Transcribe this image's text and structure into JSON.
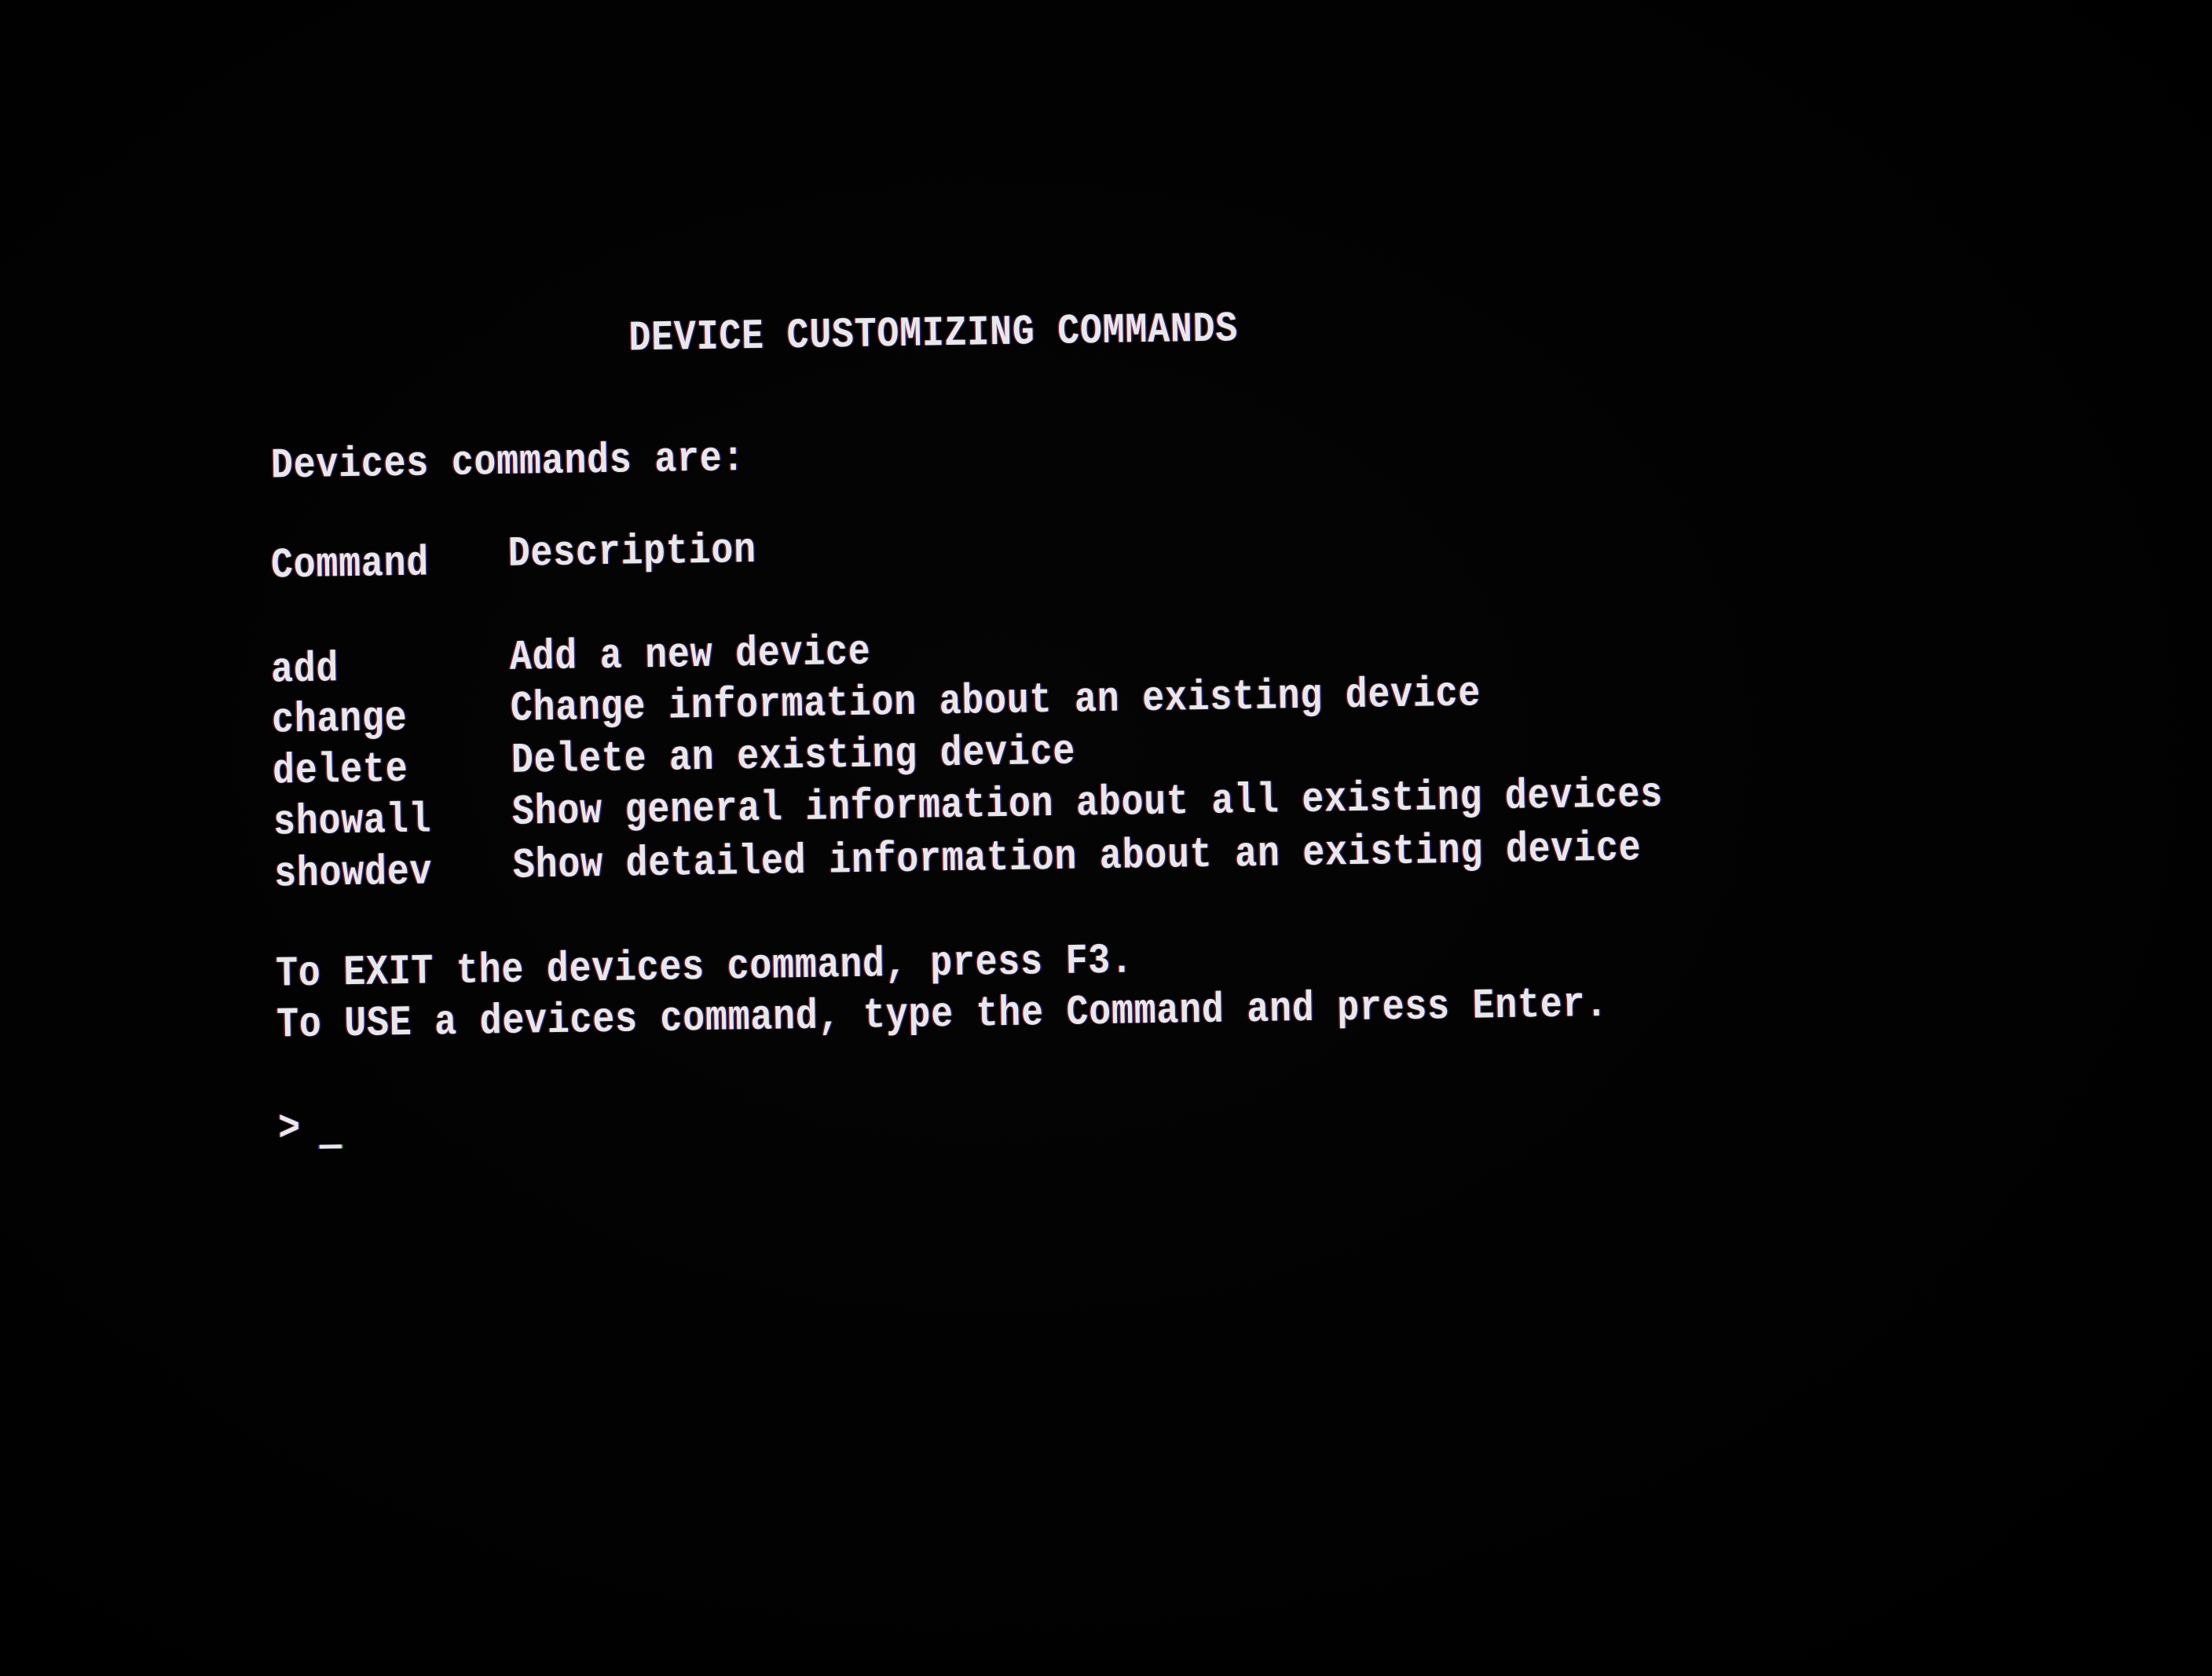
{
  "screen": {
    "title": "DEVICE CUSTOMIZING COMMANDS",
    "intro": "Devices commands are:",
    "headers": {
      "command": "Command",
      "description": "Description"
    },
    "commands": [
      {
        "command": "add",
        "description": "Add a new device"
      },
      {
        "command": "change",
        "description": "Change information about an existing device"
      },
      {
        "command": "delete",
        "description": "Delete an existing device"
      },
      {
        "command": "showall",
        "description": "Show general information about all existing devices"
      },
      {
        "command": "showdev",
        "description": "Show detailed information about an existing device"
      }
    ],
    "exit_instruction": "To EXIT the devices command, press F3.",
    "use_instruction": "To USE a devices command, type the Command and press Enter.",
    "prompt": {
      "symbol": ">",
      "value": ""
    }
  },
  "colors": {
    "background": "#000000",
    "text": "#e8e8ec"
  }
}
